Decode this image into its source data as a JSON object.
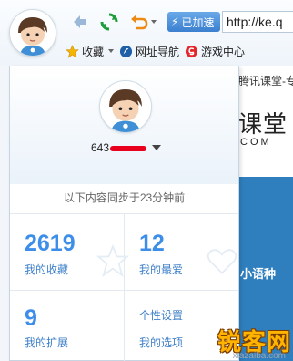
{
  "toolbar": {
    "speed_label": "已加速",
    "url_text": "http://ke.q",
    "bookmarks": [
      {
        "icon": "star-icon",
        "label": "收藏"
      },
      {
        "icon": "navigation-icon",
        "label": "网址导航"
      },
      {
        "icon": "game-icon",
        "label": "游戏中心"
      }
    ]
  },
  "page": {
    "line1": "腾讯课堂-专",
    "big": "课堂",
    "com": "COM",
    "blue_text": "小语种"
  },
  "panel": {
    "account_prefix": "643",
    "sync_text": "以下内容同步于23分钟前",
    "cells": [
      {
        "number": "2619",
        "label": "我的收藏"
      },
      {
        "number": "12",
        "label": "我的最爱"
      },
      {
        "number": "9",
        "label": "我的扩展"
      },
      {
        "number": "",
        "label": "个性设置",
        "label2": "我的选项"
      }
    ]
  },
  "watermark": {
    "text": "锐客网",
    "sub": "xiazaiba.com"
  },
  "colors": {
    "accent_blue": "#3d8ee8",
    "speed_bg": "#3b7fcf",
    "redaction": "#e8001c"
  }
}
